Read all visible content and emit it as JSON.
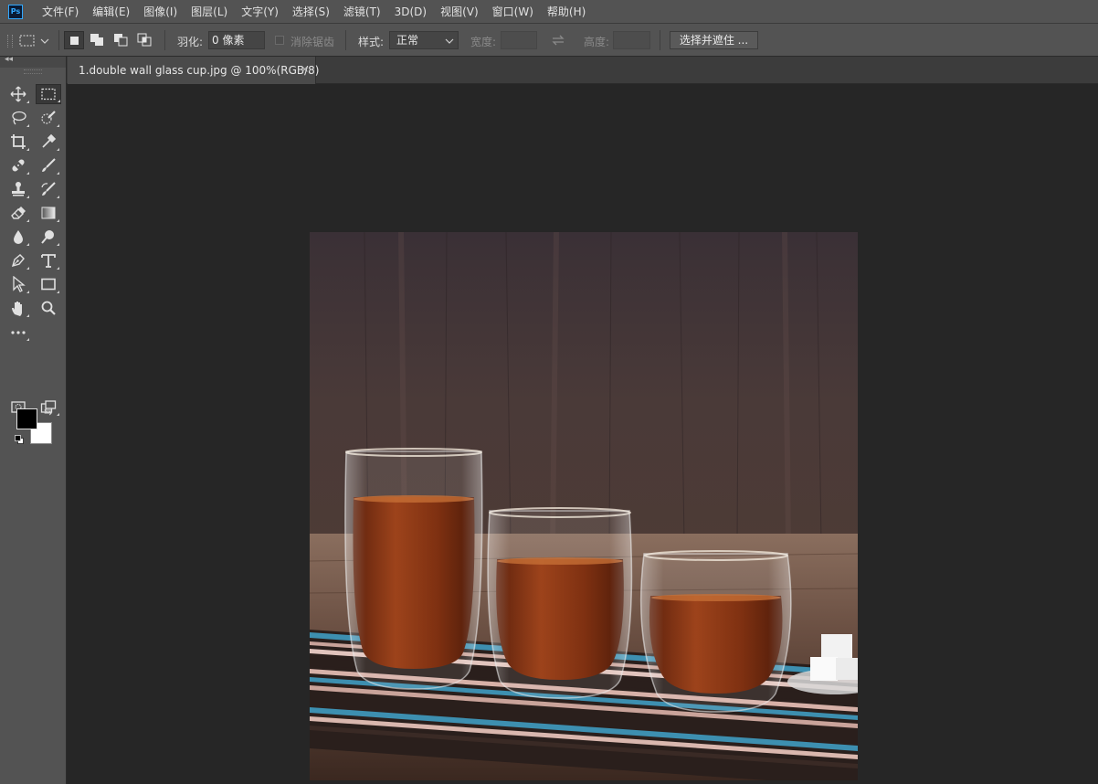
{
  "app": {
    "logo_text": "Ps"
  },
  "menu": [
    "文件(F)",
    "编辑(E)",
    "图像(I)",
    "图层(L)",
    "文字(Y)",
    "选择(S)",
    "滤镜(T)",
    "3D(D)",
    "视图(V)",
    "窗口(W)",
    "帮助(H)"
  ],
  "options": {
    "feather_label": "羽化:",
    "feather_value": "0 像素",
    "antialias_label": "消除锯齿",
    "style_label": "样式:",
    "style_value": "正常",
    "width_label": "宽度:",
    "height_label": "高度:",
    "select_mask_label": "选择并遮住 ..."
  },
  "document": {
    "tab_title": "1.double wall glass cup.jpg @ 100%(RGB/8)",
    "close_glyph": "×"
  },
  "tools": {
    "collapse_glyph": "◂◂",
    "swap_glyph": "⇆"
  },
  "colors": {
    "foreground": "#000000",
    "background": "#ffffff",
    "ui_panel": "#535353",
    "workspace": "#262626"
  }
}
